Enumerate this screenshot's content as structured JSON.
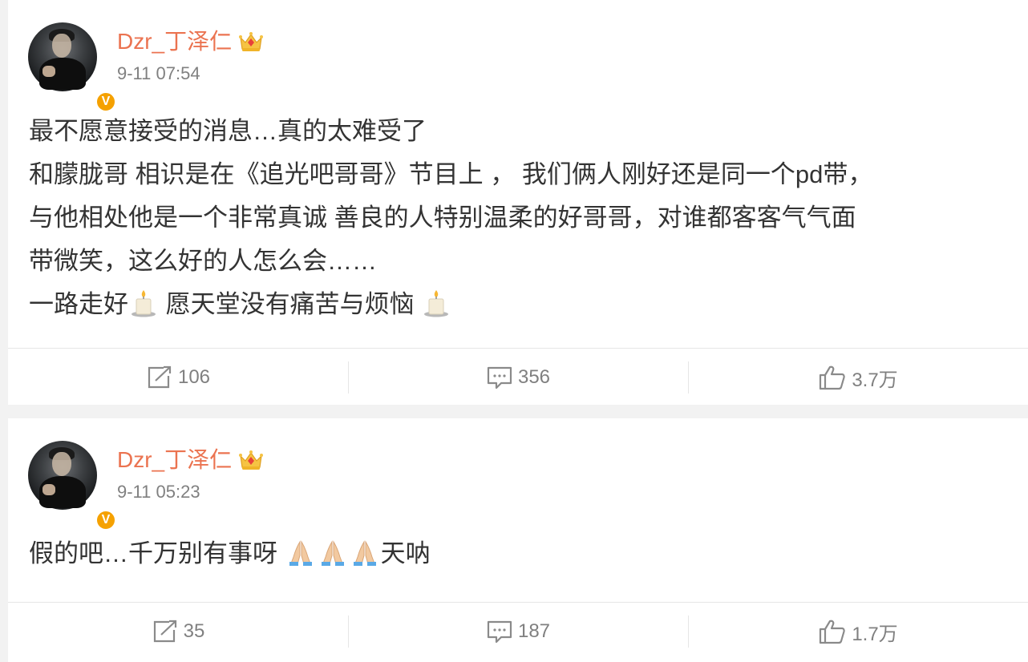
{
  "posts": [
    {
      "username": "Dzr_丁泽仁",
      "timestamp": "9-11 07:54",
      "verified_badge": "V",
      "content_lines": [
        "最不愿意接受的消息…真的太难受了",
        "和朦胧哥 相识是在《追光吧哥哥》节目上 ， 我们俩人刚好还是同一个pd带，",
        "与他相处他是一个非常真诚 善良的人特别温柔的好哥哥，对谁都客客气气面",
        "带微笑，这么好的人怎么会……"
      ],
      "last_line_a": "一路走好",
      "last_line_b": " 愿天堂没有痛苦与烦恼 ",
      "emoji_icons": [
        "candle-icon",
        "candle-icon"
      ],
      "actions": {
        "repost": "106",
        "comment": "356",
        "like": "3.7万"
      }
    },
    {
      "username": "Dzr_丁泽仁",
      "timestamp": "9-11 05:23",
      "verified_badge": "V",
      "content_a": "假的吧…千万别有事呀 ",
      "content_b": "天呐",
      "emoji_icons": [
        "pray-icon",
        "pray-icon",
        "pray-icon"
      ],
      "actions": {
        "repost": "35",
        "comment": "187",
        "like": "1.7万"
      }
    }
  ],
  "colors": {
    "username": "#eb7350",
    "timestamp": "#808080",
    "text": "#333333",
    "badge": "#f5a100",
    "background": "#f2f2f2"
  }
}
